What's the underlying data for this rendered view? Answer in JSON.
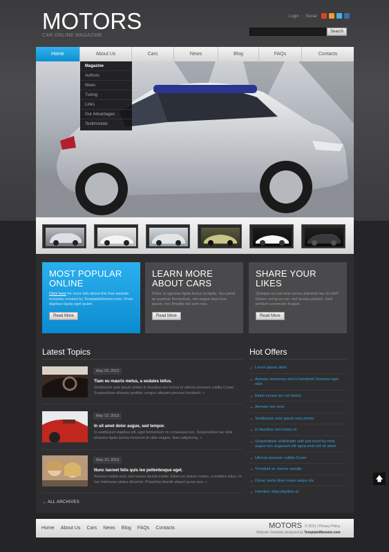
{
  "header": {
    "logo_title": "MOTORS",
    "logo_subtitle": "CAR ONLINE MAGAZINE",
    "login": "Login",
    "separator": "|",
    "social": "Social",
    "search_button": "Search",
    "search_value": ""
  },
  "social_icons": [
    {
      "name": "google-icon",
      "color": "#d8432e"
    },
    {
      "name": "rss-icon",
      "color": "#f39b23"
    },
    {
      "name": "twitter-icon",
      "color": "#4bb0e2"
    },
    {
      "name": "facebook-icon",
      "color": "#3b6cb4"
    }
  ],
  "nav": [
    "Home",
    "About Us",
    "Cars",
    "News",
    "Blog",
    "FAQs",
    "Contacts"
  ],
  "dropdown": [
    "Magazine",
    "Authors",
    "News",
    "Tuning",
    "Links",
    "Our Advantages",
    "Testimonials"
  ],
  "promos": [
    {
      "title_line1": "MOST POPULAR",
      "title_line2": "ONLINE",
      "link": "Click here",
      "text": " for more info about this free website template created by TemplateMonster.com. Proin dapibus ligula eget quam.",
      "button": "Read More"
    },
    {
      "title_line1": "LEARN MORE",
      "title_line2": "ABOUT CARS",
      "text": "Dolor, in egestas ligula lectus at ligula. Sus-pend as pulvinar fermentum, nisl augue fauci-bus ipsum, nec fringilla nisl sem non.",
      "button": "Read More"
    },
    {
      "title_line1": "SHARE YOUR",
      "title_line2": "LIKES",
      "text": "Quisque eu nisl erat cursus placerat nec id velit? Donec vel lacus nec nisl lacinia pretium. Sed pretium commodo feugiat.",
      "button": "Read More"
    }
  ],
  "latest_topics": {
    "title": "Latest Topics",
    "items": [
      {
        "date": "May 29, 2013",
        "title": "Tiam eu mauris metus, a sodales tellus.",
        "text": "Vestibulum ante ipsum primis in faucibus orci luctus et ultrices posuere cubilia Curae; Suspendisse aliquam porttitor congue aliquam placerat hendrerit.",
        "more": "»"
      },
      {
        "date": "May 12, 2013",
        "title": "In sit amet dolor augue, sed tempor.",
        "text": "In vestibulum dapibus elit, eget fermentum mi consequat non. Suspendisse nec felis pharetra ligula lacinia hendrerit id vitae magna. Nam adipiscing.",
        "more": "»"
      },
      {
        "date": "May 10, 2013",
        "title": "Nunc laoreet felis quis leo pellentesque eget.",
        "text": "Aenean mattis nunc sed massa lacinia mattis. Etiam eu mauris metus, a sodales tellus. In hac habitasse platea dictumst. Phasellus blandit aliquet purus non.",
        "more": "»"
      }
    ],
    "archives": "ALL ARCHIVES"
  },
  "hot_offers": {
    "title": "Hot Offers",
    "items": [
      "Lorem ipsum dolor",
      "Aenean nonummy sed in hendrerit Vivamus eget nibh",
      "Etiam cursus leo vel metus",
      "Aenean nec eros",
      "Vestibulum ante ipsum uma primis",
      "In faucibus orci luctus et",
      "Suspendisse sollicitudin velit sed leoul ha retra augue nec augueam elit agna.endr erit sit amet",
      "Ultrices posuere cubilia Curae",
      "Tincidunt ac viverra sesulla",
      "Donec porta diam mass usque ola",
      "Interdum vitae,dapibus ac"
    ]
  },
  "footer": {
    "nav": [
      "Home",
      "About Us",
      "Cars",
      "News",
      "Blog",
      "FAQs",
      "Contacts"
    ],
    "brand": "MOTORS",
    "copyright": "© 2013",
    "sep": "|",
    "privacy": "Privacy Policy",
    "credit_prefix": "Website Template designed by",
    "credit_name": "TemplateMonster.com"
  },
  "colors": {
    "accent_blue": "#1ba3e6",
    "link_blue": "#2ea6e4"
  }
}
